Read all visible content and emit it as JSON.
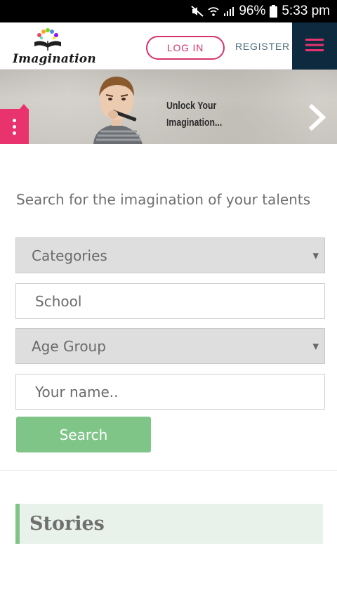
{
  "status_bar": {
    "battery": "96%",
    "time": "5:33 pm",
    "icons": [
      "mute-icon",
      "wifi-icon",
      "signal-icon",
      "battery-icon"
    ]
  },
  "header": {
    "logo_text": "Imagination",
    "login_label": "LOG IN",
    "register_label": "REGISTER",
    "menu_icon": "hamburger-icon"
  },
  "banner": {
    "line1": "Unlock Your",
    "line2": "Imagination...",
    "next_icon": "chevron-right-icon",
    "widget_icon": "more-vertical-icon"
  },
  "search": {
    "title": "Search for the imagination of your talents",
    "categories_selected": "Categories",
    "school_value": "School",
    "age_group_selected": "Age Group",
    "name_placeholder": "Your name..",
    "button_label": "Search"
  },
  "stories": {
    "title": "Stories"
  },
  "colors": {
    "accent_pink": "#d6336c",
    "navy": "#0d2a3f",
    "green": "#7ec587",
    "stories_bg": "#e8f2ea"
  }
}
